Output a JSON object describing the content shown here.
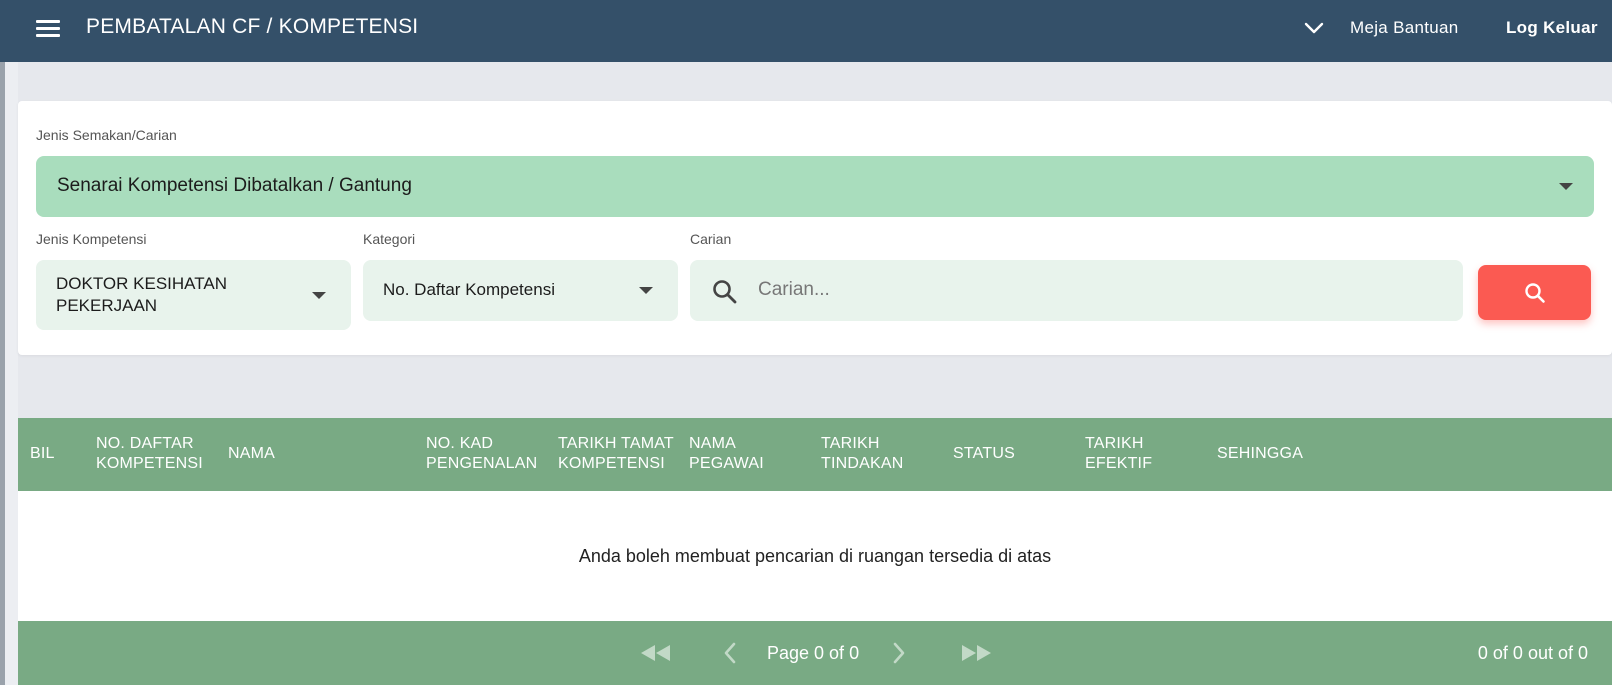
{
  "header": {
    "title": "PEMBATALAN CF / KOMPETENSI",
    "help_label": "Meja Bantuan",
    "logout_label": "Log Keluar",
    "background": "#345069"
  },
  "filters": {
    "check_type": {
      "label": "Jenis Semakan/Carian",
      "value": "Senarai Kompetensi Dibatalkan / Gantung"
    },
    "competency_type": {
      "label": "Jenis Kompetensi",
      "value_line1": "DOKTOR KESIHATAN",
      "value_line2": "PEKERJAAN"
    },
    "category": {
      "label": "Kategori",
      "value": "No. Daftar Kompetensi"
    },
    "search": {
      "label": "Carian",
      "placeholder": "Carian...",
      "value": ""
    }
  },
  "table": {
    "columns": [
      {
        "line1": "BIL",
        "line2": ""
      },
      {
        "line1": "NO. DAFTAR",
        "line2": "KOMPETENSI"
      },
      {
        "line1": "NAMA",
        "line2": ""
      },
      {
        "line1": "NO. KAD",
        "line2": "PENGENALAN"
      },
      {
        "line1": "TARIKH TAMAT",
        "line2": "KOMPETENSI"
      },
      {
        "line1": "NAMA",
        "line2": "PEGAWAI"
      },
      {
        "line1": "TARIKH",
        "line2": "TINDAKAN"
      },
      {
        "line1": "STATUS",
        "line2": ""
      },
      {
        "line1": "TARIKH",
        "line2": "EFEKTIF"
      },
      {
        "line1": "SEHINGGA",
        "line2": ""
      }
    ],
    "empty_message": "Anda boleh membuat pencarian di ruangan tersedia di atas"
  },
  "pagination": {
    "page_text": "Page 0 of 0",
    "count_text": "0 of 0 out of 0"
  },
  "icons": {
    "menu": "hamburger-icon",
    "header_dropdown": "chevron-down-icon",
    "search": "magnifier-icon",
    "first": "double-left-icon",
    "prev": "chevron-left-icon",
    "next": "chevron-right-icon",
    "last": "double-right-icon"
  },
  "colors": {
    "accent_green": "#79aa84",
    "select_green": "#a9ddbd",
    "search_button": "#fb5a52"
  }
}
